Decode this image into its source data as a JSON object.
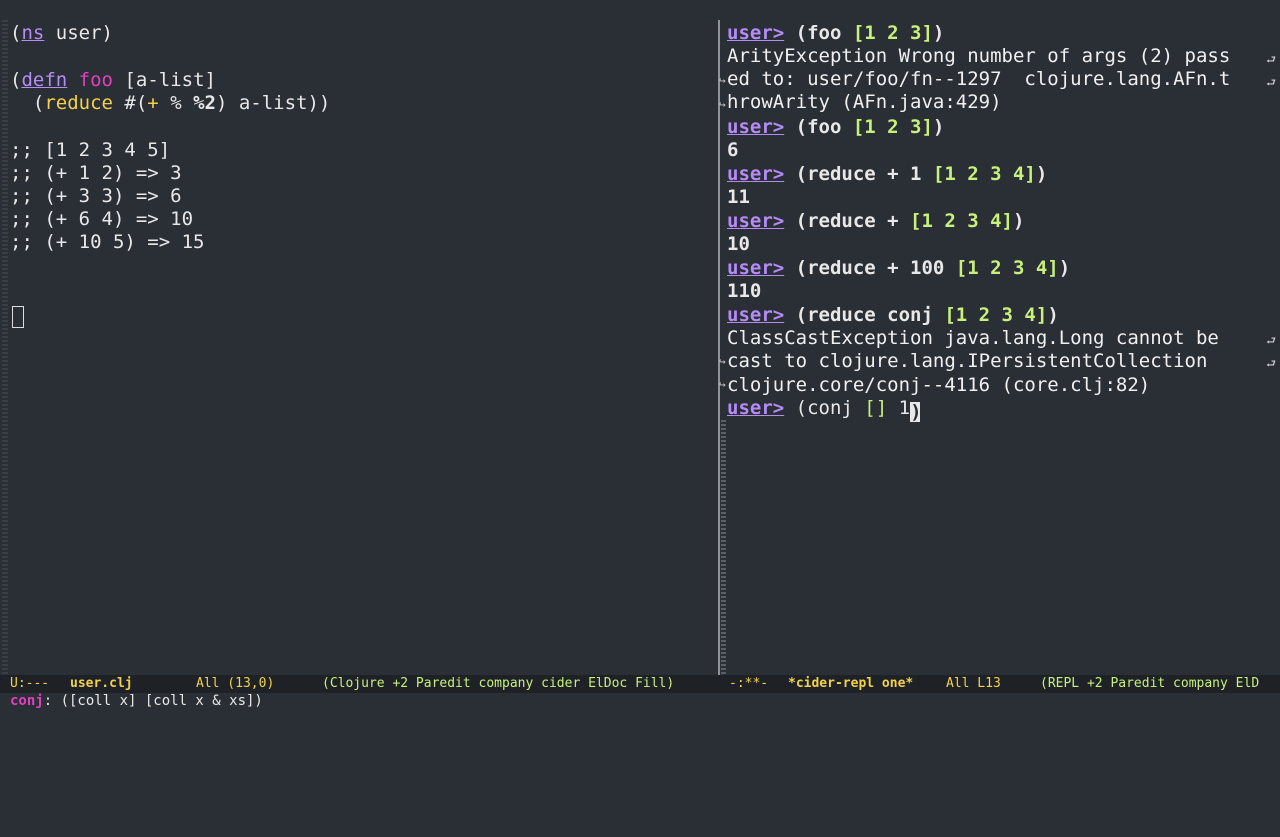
{
  "left_buffer": {
    "ns_open": "(",
    "ns_kw": "ns",
    "ns_rest": " user)",
    "defn_open": "(",
    "defn_kw": "defn",
    "defn_sp": " ",
    "defn_name": "foo",
    "defn_args": " [a-list]",
    "reduce_indent": "  (",
    "reduce_kw": "reduce",
    "reduce_hash": " #(",
    "reduce_plus": "+",
    "reduce_pct": " % ",
    "reduce_pct2": "%2",
    "reduce_rest": ") a-list))",
    "comments": [
      ";; [1 2 3 4 5]",
      ";; (+ 1 2) => 3",
      ";; (+ 3 3) => 6",
      ";; (+ 6 4) => 10",
      ";; (+ 10 5) => 15"
    ]
  },
  "repl": {
    "prompt": "user>",
    "lines": {
      "l1_open": " (foo ",
      "l1_vec": "[1 2 3]",
      "l1_close": ")",
      "e1a": "ArityException Wrong number of args (2) pass",
      "e1b": "ed to: user/foo/fn--1297  clojure.lang.AFn.t",
      "e1c": "hrowArity (AFn.java:429)",
      "l2_open": " (foo ",
      "l2_vec": "[1 2 3]",
      "l2_close": ")",
      "r2": "6",
      "l3_open": " (reduce + 1 ",
      "l3_vec": "[1 2 3 4]",
      "l3_close": ")",
      "r3": "11",
      "l4_open": " (reduce + ",
      "l4_vec": "[1 2 3 4]",
      "l4_close": ")",
      "r4": "10",
      "l5_open": " (reduce + 100 ",
      "l5_vec": "[1 2 3 4]",
      "l5_close": ")",
      "r5": "110",
      "l6_open": " (reduce conj ",
      "l6_vec": "[1 2 3 4]",
      "l6_close": ")",
      "e6a": "ClassCastException java.lang.Long cannot be",
      "e6b": "cast to clojure.lang.IPersistentCollection",
      "e6c": "clojure.core/conj--4116 (core.clj:82)",
      "l7_open": " (conj ",
      "l7_vec": "[]",
      "l7_rest": " 1",
      "l7_cursor": ")"
    }
  },
  "modeline": {
    "left_state": "U:---",
    "left_buffer": "user.clj",
    "left_pos": "All (13,0)",
    "left_modes": "(Clojure +2 Paredit company cider ElDoc Fill)",
    "right_state": "-:**-",
    "right_buffer": "*cider-repl one*",
    "right_pos": "All L13",
    "right_modes": "(REPL +2 Paredit company ElD"
  },
  "minibuffer": {
    "fn": "conj",
    "sig": ": ([coll x] [coll x & xs])"
  }
}
